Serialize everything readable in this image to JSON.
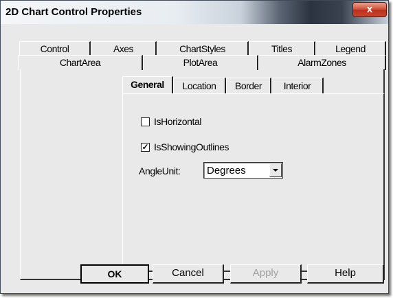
{
  "window": {
    "title": "2D Chart Control Properties",
    "close_glyph": "x"
  },
  "tabs_row1": [
    {
      "label": "Control"
    },
    {
      "label": "Axes"
    },
    {
      "label": "ChartStyles"
    },
    {
      "label": "Titles"
    },
    {
      "label": "Legend"
    }
  ],
  "tabs_row2": [
    {
      "label": "ChartArea",
      "selected": true
    },
    {
      "label": "PlotArea"
    },
    {
      "label": "AlarmZones"
    }
  ],
  "subtabs": [
    {
      "label": "General",
      "selected": true
    },
    {
      "label": "Location"
    },
    {
      "label": "Border"
    },
    {
      "label": "Interior"
    }
  ],
  "general": {
    "is_horizontal": {
      "label": "IsHorizontal",
      "checked": false,
      "mark": ""
    },
    "is_showing_outlines": {
      "label": "IsShowingOutlines",
      "checked": true,
      "mark": "✓"
    },
    "angle_unit": {
      "label": "AngleUnit:",
      "value": "Degrees"
    }
  },
  "buttons": {
    "ok": "OK",
    "cancel": "Cancel",
    "apply": "Apply",
    "help": "Help"
  },
  "colors": {
    "window_bg": "#e9e9e9",
    "close_button": "#c8462e",
    "disabled_text": "#a0a0a0"
  }
}
